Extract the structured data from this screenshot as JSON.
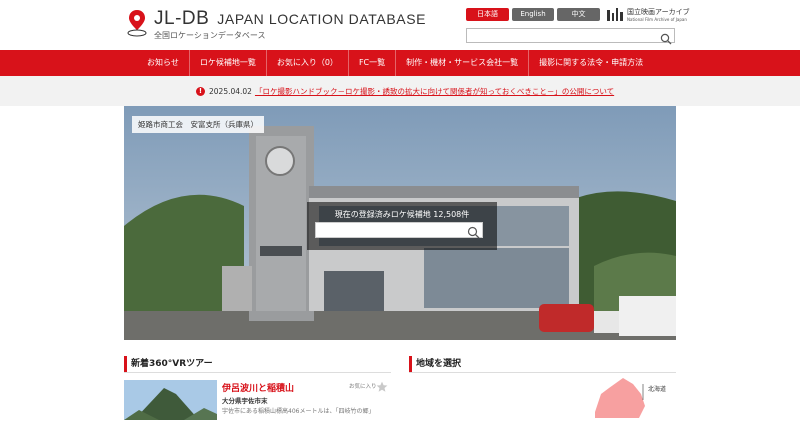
{
  "logo": {
    "title_main": "JL-DB",
    "title_rest": "JAPAN LOCATION DATABASE",
    "subtitle": "全国ロケーションデータベース"
  },
  "languages": [
    {
      "label": "日本語",
      "active": true
    },
    {
      "label": "English",
      "active": false
    },
    {
      "label": "中文",
      "active": false
    }
  ],
  "nfa": {
    "mark": "NFAJ",
    "jp": "国立映画アーカイブ",
    "en": "National Film Archive of Japan"
  },
  "search_top": {
    "placeholder": ""
  },
  "nav": [
    "お知らせ",
    "ロケ候補地一覧",
    "お気に入り（0）",
    "FC一覧",
    "制作・機材・サービス会社一覧",
    "撮影に関する法令・申請方法"
  ],
  "notice": {
    "icon": "!",
    "date": "2025.04.02",
    "text": "「ロケ撮影ハンドブック－ロケ撮影・誘致の拡大に向けて関係者が知っておくべきこと－」の公開について"
  },
  "hero": {
    "caption": "姫路市商工会　安富支所（兵庫県）",
    "count_label": "現在の登録済みロケ候補地 12,508件",
    "search_placeholder": ""
  },
  "sections": {
    "vr_title": "新着360°VRツアー",
    "region_title": "地域を選択"
  },
  "vr_card": {
    "title": "伊呂波川と稲積山",
    "location": "大分県宇佐市末",
    "description": "宇佐市にある稲積山標高406メートルは、「四岐竹の郷」",
    "favorite_label": "お気に入り"
  },
  "map": {
    "hokkaido_label": "北海道"
  },
  "colors": {
    "brand": "#d8121a",
    "nav_bg": "#d8121a",
    "notice_bg": "#f2f2f2"
  }
}
